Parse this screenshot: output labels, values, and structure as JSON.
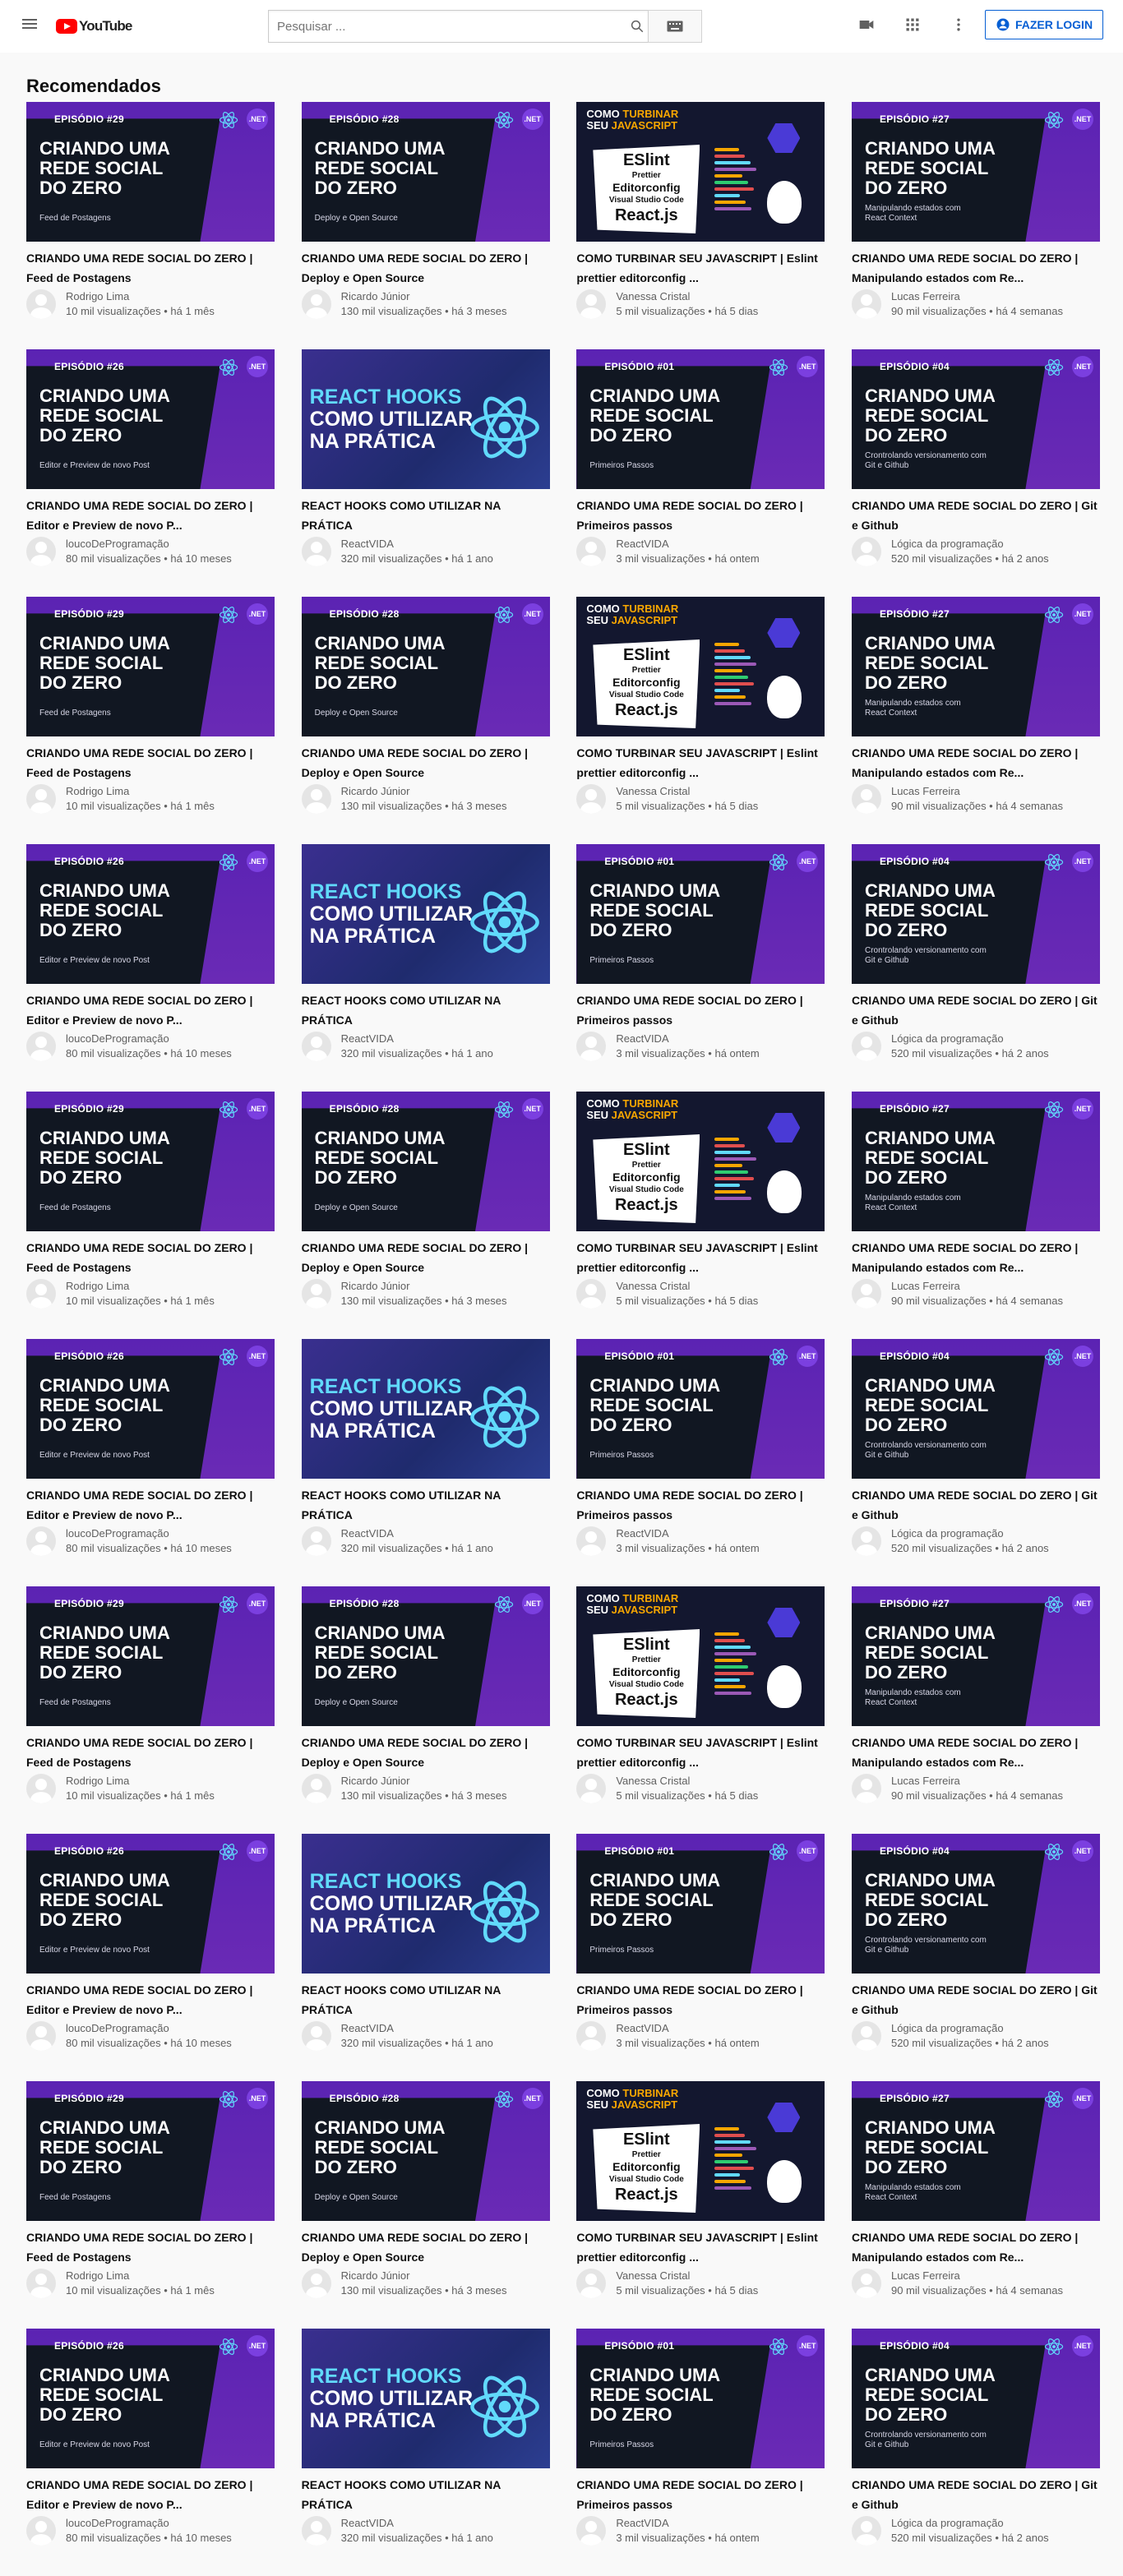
{
  "app": {
    "logo_text": "YouTube"
  },
  "header": {
    "search_placeholder": "Pesquisar ...",
    "login_label": "FAZER LOGIN"
  },
  "section": {
    "title": "Recomendados"
  },
  "colors": {
    "accent": "#065fd4",
    "brand": "#ff0000",
    "purple": "#5b23b3",
    "dark": "#111722"
  },
  "templates": [
    {
      "kind": "net",
      "episode": "EPISÓDIO #29",
      "thumb_title": "CRIANDO UMA\nREDE SOCIAL\nDO ZERO",
      "caption": "Feed de Postagens",
      "title": "CRIANDO UMA REDE SOCIAL DO ZERO | Feed de Postagens",
      "channel": "Rodrigo Lima",
      "stats": "10 mil visualizações • há 1 mês"
    },
    {
      "kind": "net",
      "episode": "EPISÓDIO #28",
      "thumb_title": "CRIANDO UMA\nREDE SOCIAL\nDO ZERO",
      "caption": "Deploy e Open Source",
      "title": "CRIANDO UMA REDE SOCIAL DO ZERO | Deploy e Open Source",
      "channel": "Ricardo Júnior",
      "stats": "130 mil visualizações • há 3 meses"
    },
    {
      "kind": "js",
      "title": "COMO TURBINAR SEU JAVASCRIPT | Eslint prettier editorconfig ...",
      "channel": "Vanessa Cristal",
      "stats": "5 mil visualizações • há 5 dias"
    },
    {
      "kind": "net",
      "episode": "EPISÓDIO #27",
      "thumb_title": "CRIANDO UMA\nREDE SOCIAL\nDO ZERO",
      "caption": "Manipulando estados com\nReact Context",
      "title": "CRIANDO UMA REDE SOCIAL DO ZERO | Manipulando estados com Re...",
      "channel": "Lucas Ferreira",
      "stats": "90 mil visualizações • há 4 semanas"
    },
    {
      "kind": "net",
      "episode": "EPISÓDIO #26",
      "thumb_title": "CRIANDO UMA\nREDE SOCIAL\nDO ZERO",
      "caption": "Editor e Preview de novo Post",
      "title": "CRIANDO UMA REDE SOCIAL DO ZERO | Editor e Preview de novo P...",
      "channel": "loucoDeProgramação",
      "stats": "80 mil visualizações • há 10 meses"
    },
    {
      "kind": "hooks",
      "title": "REACT HOOKS COMO UTILIZAR NA PRÁTICA",
      "channel": "ReactVIDA",
      "stats": "320 mil visualizações • há 1 ano"
    },
    {
      "kind": "net",
      "episode": "EPISÓDIO #01",
      "thumb_title": "CRIANDO UMA\nREDE SOCIAL\nDO ZERO",
      "caption": "Primeiros Passos",
      "title": "CRIANDO UMA REDE SOCIAL DO ZERO | Primeiros passos",
      "channel": "ReactVIDA",
      "stats": "3 mil visualizações • há ontem"
    },
    {
      "kind": "net",
      "episode": "EPISÓDIO #04",
      "thumb_title": "CRIANDO UMA\nREDE SOCIAL\nDO ZERO",
      "caption": "Crontrolando versionamento com\nGit e Github",
      "title": "CRIANDO UMA REDE SOCIAL DO ZERO | Git e Github",
      "channel": "Lógica da programação",
      "stats": "520 mil visualizações • há 2 anos"
    }
  ],
  "js_thumb": {
    "head1": "COMO ",
    "head_orange1": "TURBINAR",
    "head2": "SEU ",
    "head_orange2": "JAVASCRIPT",
    "l1": "ESlint",
    "l2": "Prettier",
    "l3": "Editorconfig",
    "l4": "Visual Studio Code",
    "l5": "React.js"
  },
  "hooks_thumb": {
    "line1": "REACT HOOKS",
    "line2": "COMO UTILIZAR",
    "line3": "NA PRÁTICA"
  },
  "net_badge": ".NET",
  "rows": [
    [
      0,
      1,
      2,
      3
    ],
    [
      4,
      5,
      6,
      7
    ],
    [
      0,
      1,
      2,
      3
    ],
    [
      4,
      5,
      6,
      7
    ],
    [
      0,
      1,
      2,
      3
    ],
    [
      4,
      5,
      6,
      7
    ],
    [
      0,
      1,
      2,
      3
    ],
    [
      4,
      5,
      6,
      7
    ],
    [
      0,
      1,
      2,
      3
    ],
    [
      4,
      5,
      6,
      7
    ]
  ]
}
